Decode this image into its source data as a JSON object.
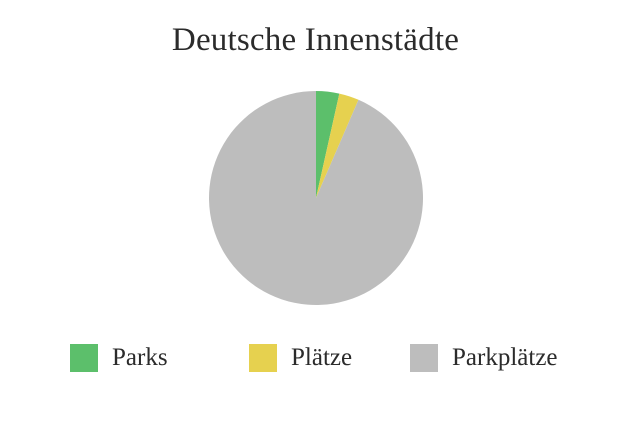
{
  "chart_data": {
    "type": "pie",
    "title": "Deutsche Innenstädte",
    "labels": [
      "Parks",
      "Plätze",
      "Parkplätze"
    ],
    "values": [
      3.5,
      3,
      93.5
    ],
    "colors": [
      "#5cbf6b",
      "#e6d14f",
      "#bdbdbd"
    ],
    "legend_position": "bottom"
  }
}
